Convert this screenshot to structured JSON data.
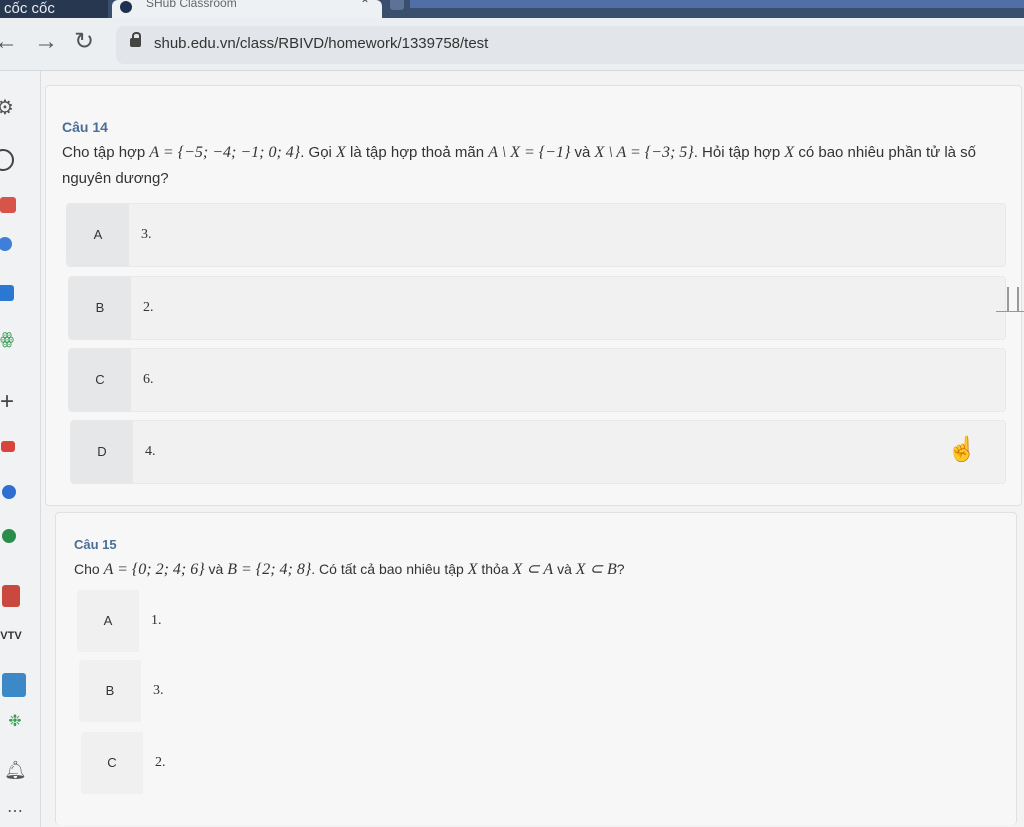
{
  "browser": {
    "brand": "cốc cốc",
    "tab_title": "SHub Classroom",
    "tab_close": "⌃",
    "url": "shub.edu.vn/class/RBIVD/homework/1339758/test"
  },
  "icons": {
    "back": "←",
    "forward": "→",
    "reload": "↻",
    "add": "+"
  },
  "questions": [
    {
      "title": "Câu 14",
      "text": {
        "p1": "Cho tập hợp ",
        "m1": "A = {−5; −4; −1; 0; 4}",
        "p2": ". Gọi ",
        "m2": "X",
        "p3": " là tập hợp thoả mãn ",
        "m3": "A \\ X = {−1}",
        "p4": " và ",
        "m4": "X \\ A = {−3; 5}",
        "p5": ". Hỏi tập hợp ",
        "m5": "X",
        "p6": " có bao nhiêu phần tử là số nguyên dương?"
      },
      "options": [
        {
          "label": "A",
          "value": "3."
        },
        {
          "label": "B",
          "value": "2."
        },
        {
          "label": "C",
          "value": "6."
        },
        {
          "label": "D",
          "value": "4."
        }
      ]
    },
    {
      "title": "Câu 15",
      "text": {
        "p1": "Cho ",
        "m1": "A = {0; 2; 4; 6}",
        "p2": " và ",
        "m2": "B = {2; 4; 8}",
        "p3": ". Có tất cả bao nhiêu tập ",
        "m3": "X",
        "p4": " thỏa ",
        "m4": "X ⊂ A",
        "p5": " và ",
        "m5": "X ⊂ B",
        "p6": "?"
      },
      "options": [
        {
          "label": "A",
          "value": "1."
        },
        {
          "label": "B",
          "value": "3."
        },
        {
          "label": "C",
          "value": "2."
        }
      ]
    }
  ]
}
